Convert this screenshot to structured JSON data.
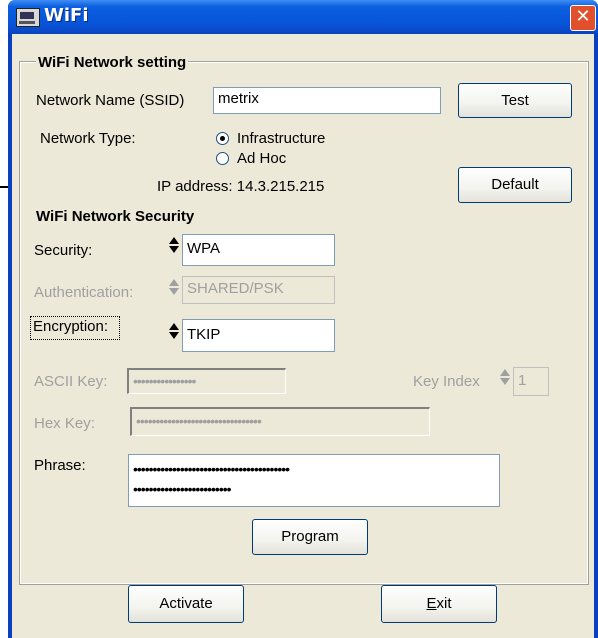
{
  "window": {
    "title": "WiFi",
    "close_glyph": "✕"
  },
  "network": {
    "section_title": "WiFi Network setting",
    "ssid_label": "Network Name (SSID)",
    "ssid_value": "metrix",
    "test_button": "Test",
    "type_label": "Network Type:",
    "type_options": [
      "Infrastructure",
      "Ad Hoc"
    ],
    "type_selected": "Infrastructure",
    "ip_text": "IP address: 14.3.215.215",
    "default_button": "Default"
  },
  "security": {
    "section_title": "WiFi Network Security",
    "security_label": "Security:",
    "security_value": "WPA",
    "auth_label": "Authentication:",
    "auth_value": "SHARED/PSK",
    "encryption_label": "Encryption:",
    "encryption_value": "TKIP",
    "ascii_label": "ASCII Key:",
    "ascii_value": "••••••••••••••••",
    "key_index_label": "Key Index",
    "key_index_value": "1",
    "hex_label": "Hex Key:",
    "hex_value": "••••••••••••••••••••••••••••••••",
    "phrase_label": "Phrase:",
    "phrase_line1": "••••••••••••••••••••••••••••••••••••••••",
    "phrase_line2": "•••••••••••••••••••••••••",
    "program_button": "Program"
  },
  "footer": {
    "activate_button": "Activate",
    "exit_button": "Exit",
    "exit_mnemonic": "E",
    "exit_rest": "xit"
  },
  "icons": {
    "app": "network-card-icon",
    "close": "close-icon"
  },
  "colors": {
    "titlebar": "#0854d8",
    "client_bg": "#ece9d8",
    "close": "#e0502c",
    "disabled_text": "#a0a0a0"
  }
}
